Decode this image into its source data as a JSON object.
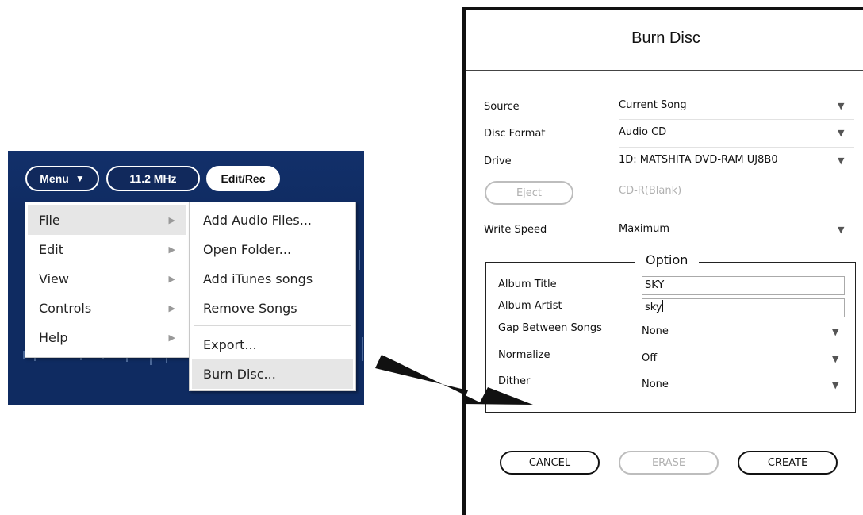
{
  "player": {
    "menu_button": "Menu",
    "menu_button_icon": "triangle-down",
    "freq_button": "11.2 MHz",
    "editrec_button": "Edit/Rec",
    "main_menu": [
      {
        "label": "File",
        "arrow": "▶",
        "highlighted": true
      },
      {
        "label": "Edit",
        "arrow": "▶"
      },
      {
        "label": "View",
        "arrow": "▶"
      },
      {
        "label": "Controls",
        "arrow": "▶"
      },
      {
        "label": "Help",
        "arrow": "▶"
      }
    ],
    "file_submenu": [
      {
        "label": "Add Audio Files..."
      },
      {
        "label": "Open Folder..."
      },
      {
        "label": "Add iTunes songs"
      },
      {
        "label": "Remove Songs"
      },
      {
        "label": "Export..."
      },
      {
        "label": "Burn Disc...",
        "highlighted": true
      }
    ]
  },
  "dialog": {
    "title": "Burn Disc",
    "source": {
      "label": "Source",
      "value": "Current Song"
    },
    "disc_format": {
      "label": "Disc Format",
      "value": "Audio CD"
    },
    "drive": {
      "label": "Drive",
      "value": "1D: MATSHITA DVD-RAM UJ8B0"
    },
    "eject_button": "Eject",
    "disc_status": "CD-R(Blank)",
    "write_speed": {
      "label": "Write Speed",
      "value": "Maximum"
    },
    "option": {
      "legend": "Option",
      "album_title": {
        "label": "Album Title",
        "value": "SKY"
      },
      "album_artist": {
        "label": "Album Artist",
        "value": "sky"
      },
      "gap": {
        "label": "Gap Between Songs",
        "value": "None"
      },
      "normalize": {
        "label": "Normalize",
        "value": "Off"
      },
      "dither": {
        "label": "Dither",
        "value": "None"
      }
    },
    "dropdown_glyph": "▼",
    "cancel_button": "CANCEL",
    "erase_button": "ERASE",
    "create_button": "CREATE"
  },
  "colors": {
    "player_bg": "#0d2658",
    "menu_highlight": "#e6e6e6",
    "disabled_text": "#b0b0b0"
  }
}
